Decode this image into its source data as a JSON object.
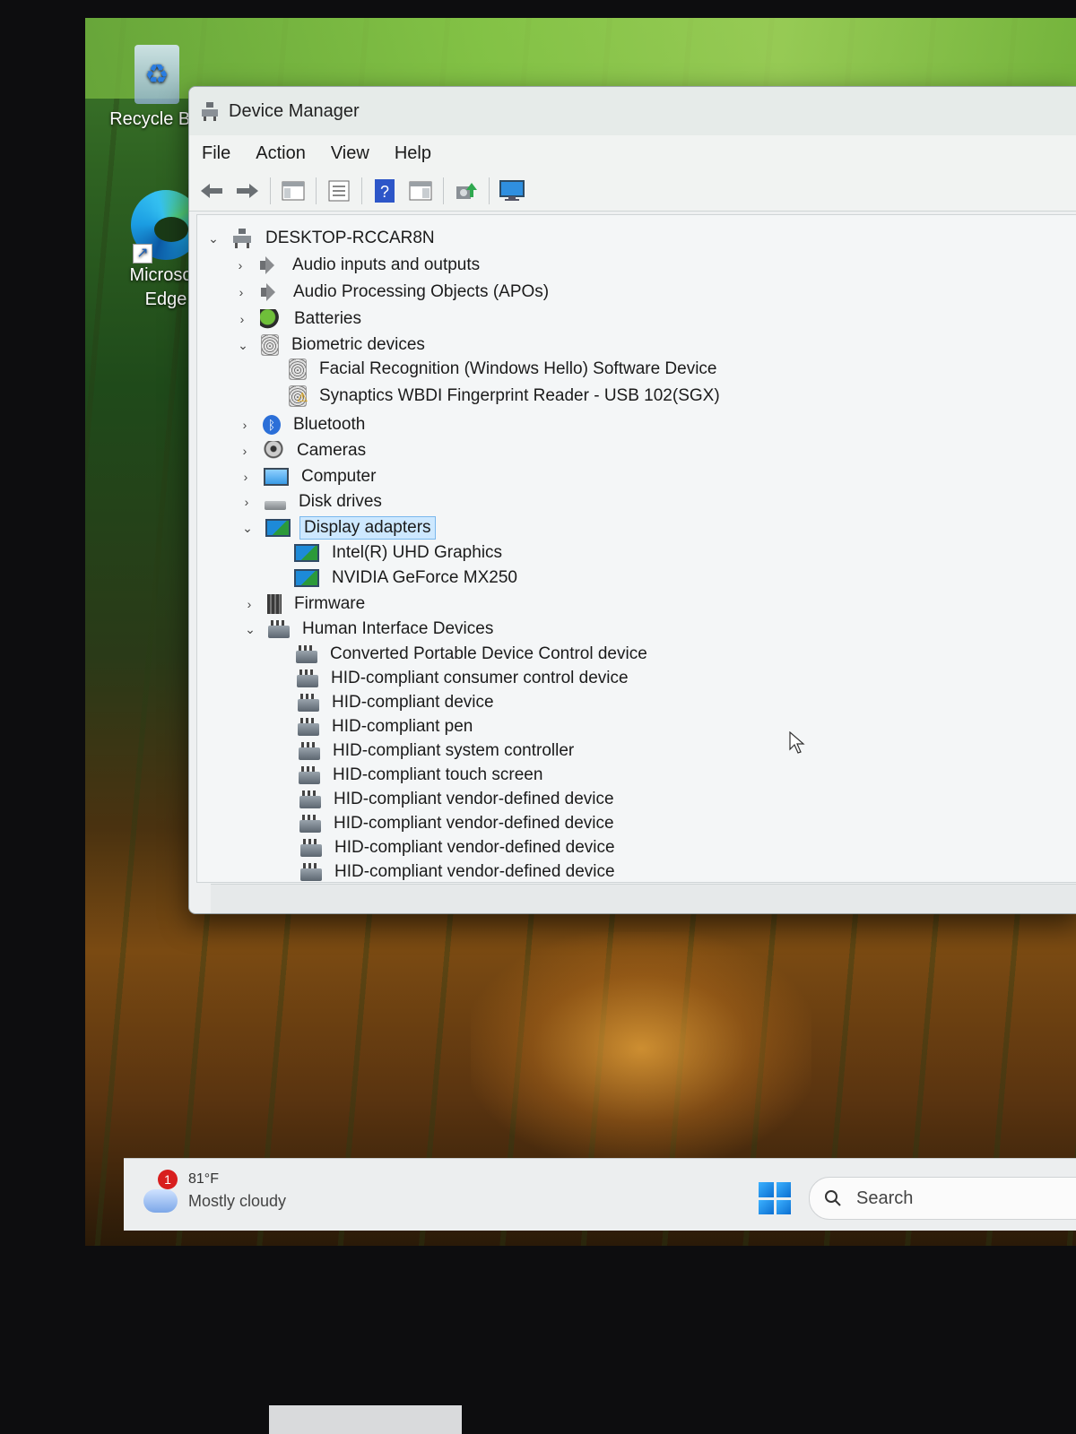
{
  "desktop": {
    "icons": [
      {
        "label": "Recycle Bin"
      },
      {
        "label": "Microsoft Edge"
      }
    ]
  },
  "window": {
    "title": "Device Manager",
    "menu": [
      "File",
      "Action",
      "View",
      "Help"
    ]
  },
  "tree": {
    "root": "DESKTOP-RCCAR8N",
    "nodes": [
      {
        "label": "Audio inputs and outputs",
        "expanded": false,
        "icon": "speaker-icon"
      },
      {
        "label": "Audio Processing Objects (APOs)",
        "expanded": false,
        "icon": "speaker-icon"
      },
      {
        "label": "Batteries",
        "expanded": false,
        "icon": "battery-icon"
      },
      {
        "label": "Biometric devices",
        "expanded": true,
        "icon": "fingerprint-icon",
        "children": [
          {
            "label": "Facial Recognition (Windows Hello) Software Device",
            "icon": "fingerprint-icon"
          },
          {
            "label": "Synaptics WBDI Fingerprint Reader - USB 102(SGX)",
            "icon": "fingerprint-warning-icon"
          }
        ]
      },
      {
        "label": "Bluetooth",
        "expanded": false,
        "icon": "bluetooth-icon"
      },
      {
        "label": "Cameras",
        "expanded": false,
        "icon": "camera-icon"
      },
      {
        "label": "Computer",
        "expanded": false,
        "icon": "monitor-icon"
      },
      {
        "label": "Disk drives",
        "expanded": false,
        "icon": "disk-icon"
      },
      {
        "label": "Display adapters",
        "expanded": true,
        "selected": true,
        "icon": "display-adapter-icon",
        "children": [
          {
            "label": "Intel(R) UHD Graphics",
            "icon": "display-adapter-icon"
          },
          {
            "label": "NVIDIA GeForce MX250",
            "icon": "display-adapter-icon"
          }
        ]
      },
      {
        "label": "Firmware",
        "expanded": false,
        "icon": "chip-icon"
      },
      {
        "label": "Human Interface Devices",
        "expanded": true,
        "icon": "hid-icon",
        "children": [
          {
            "label": "Converted Portable Device Control device",
            "icon": "hid-icon"
          },
          {
            "label": "HID-compliant consumer control device",
            "icon": "hid-icon"
          },
          {
            "label": "HID-compliant device",
            "icon": "hid-icon"
          },
          {
            "label": "HID-compliant pen",
            "icon": "hid-icon"
          },
          {
            "label": "HID-compliant system controller",
            "icon": "hid-icon"
          },
          {
            "label": "HID-compliant touch screen",
            "icon": "hid-icon"
          },
          {
            "label": "HID-compliant vendor-defined device",
            "icon": "hid-icon"
          },
          {
            "label": "HID-compliant vendor-defined device",
            "icon": "hid-icon"
          },
          {
            "label": "HID-compliant vendor-defined device",
            "icon": "hid-icon"
          },
          {
            "label": "HID-compliant vendor-defined device",
            "icon": "hid-icon"
          }
        ]
      }
    ]
  },
  "taskbar": {
    "weather": {
      "badge": "1",
      "temp": "81°F",
      "condition": "Mostly cloudy"
    },
    "search_placeholder": "Search"
  },
  "colors": {
    "selection": "#cde8ff",
    "accent": "#0c6fd1"
  }
}
